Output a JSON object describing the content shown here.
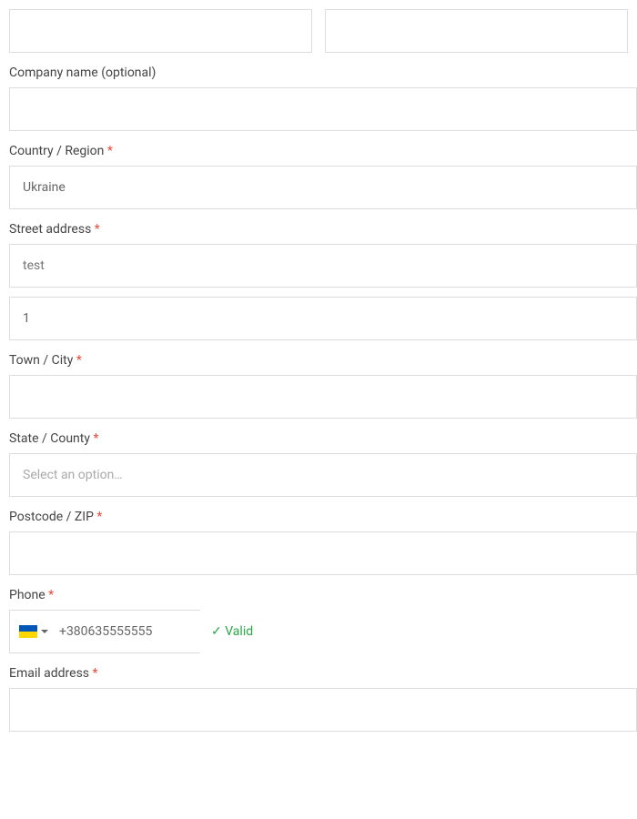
{
  "form": {
    "first_name": {
      "value": ""
    },
    "last_name": {
      "value": ""
    },
    "company": {
      "label": "Company name (optional)",
      "value": ""
    },
    "country": {
      "label": "Country / Region",
      "value": "Ukraine"
    },
    "street": {
      "label": "Street address",
      "line1": {
        "placeholder": "test",
        "value": ""
      },
      "line2": {
        "value": "1"
      }
    },
    "city": {
      "label": "Town / City",
      "value": ""
    },
    "state": {
      "label": "State / County",
      "placeholder": "Select an option…"
    },
    "postcode": {
      "label": "Postcode / ZIP",
      "value": ""
    },
    "phone": {
      "label": "Phone",
      "value": "+380635555555",
      "valid_text": "✓ Valid"
    },
    "email": {
      "label": "Email address",
      "value": ""
    }
  },
  "required_marker": "*"
}
